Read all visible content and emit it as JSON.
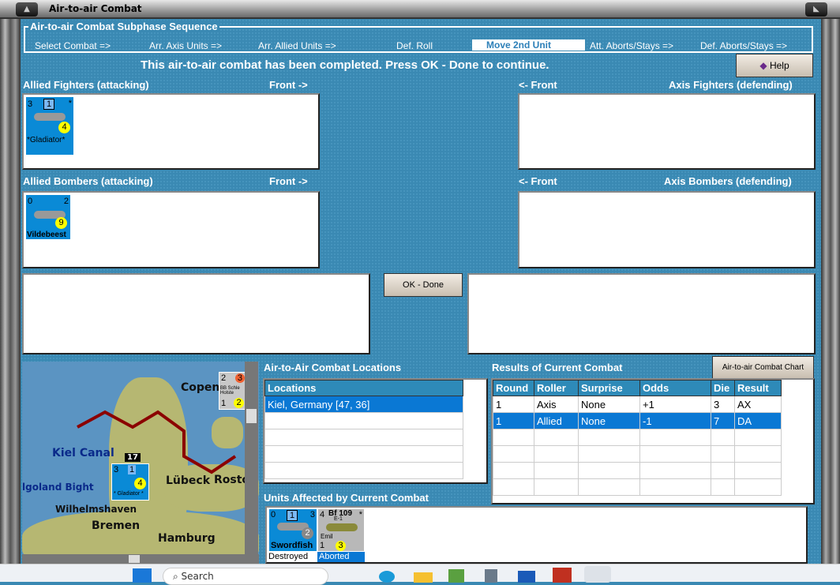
{
  "window": {
    "title": "Air-to-air Combat"
  },
  "sequence": {
    "legend": "Air-to-air Combat Subphase Sequence",
    "steps": [
      "Select Combat =>",
      "Arr. Axis Units =>",
      "Arr. Allied Units =>",
      "Def. Roll",
      "Move 2nd Unit",
      "Att. Aborts/Stays =>",
      "Def. Aborts/Stays =>"
    ],
    "active_index": 4
  },
  "status_message": "This air-to-air combat has been completed.  Press OK - Done to continue.",
  "help_label": "Help",
  "panels": {
    "allied_fighters": "Allied Fighters (attacking)",
    "axis_fighters": "Axis Fighters (defending)",
    "allied_bombers": "Allied Bombers (attacking)",
    "axis_bombers": "Axis Bombers (defending)",
    "front_right": "Front ->",
    "front_left": "<- Front"
  },
  "units": {
    "gladiator": {
      "name": "*Gladiator*",
      "tl": "3",
      "tc": "1",
      "tr": "*",
      "br": "4"
    },
    "wildebeest": {
      "name": "Vildebeest",
      "tl": "0",
      "tr": "2",
      "br": "9"
    }
  },
  "ok_label": "OK - Done",
  "map": {
    "labels": [
      "Copen",
      "Kiel Canal",
      "lgoland Bight",
      "Lübeck",
      "Rosto",
      "Wilhelmshaven",
      "Bremen",
      "Hamburg"
    ],
    "stack_count": "17",
    "map_gladiator": {
      "tl": "3",
      "tc": "1",
      "br": "4",
      "name": "* Gladiator *"
    },
    "ship": {
      "tl": "2",
      "tr": "3",
      "name": "BB Schle Holste",
      "bl": "1",
      "br": "2"
    }
  },
  "locations": {
    "title": "Air-to-Air Combat Locations",
    "header": "Locations",
    "rows": [
      "Kiel, Germany [47, 36]"
    ]
  },
  "results": {
    "title": "Results of Current Combat",
    "chart_button": "Air-to-air Combat Chart",
    "columns": [
      "Round",
      "Roller",
      "Surprise",
      "Odds",
      "Die",
      "Result"
    ],
    "rows": [
      [
        "1",
        "Axis",
        "None",
        "+1",
        "3",
        "AX"
      ],
      [
        "1",
        "Allied",
        "None",
        "-1",
        "7",
        "DA"
      ]
    ]
  },
  "affected": {
    "title": "Units Affected by Current Combat",
    "units": [
      {
        "name": "Swordfish",
        "tl": "0",
        "tc": "1",
        "tr": "3",
        "br": "2",
        "status": "Destroyed"
      },
      {
        "name": "Bf 109",
        "sub": "E-1",
        "nick": "Emil",
        "tl": "4",
        "tr": "*",
        "bl": "1",
        "br": "3",
        "status": "Aborted"
      }
    ]
  },
  "taskbar": {
    "search": "Search"
  }
}
